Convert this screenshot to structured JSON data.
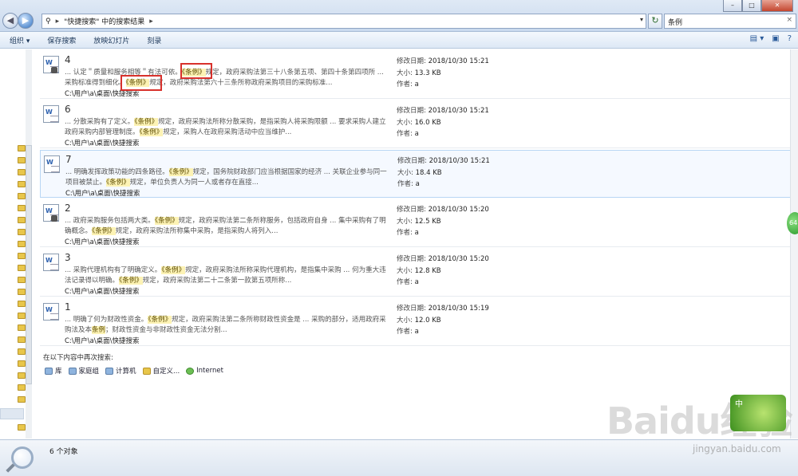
{
  "window": {
    "min": "–",
    "max": "□",
    "close": "✕"
  },
  "address": {
    "sep": "▸",
    "location": "\"快捷搜索\" 中的搜索结果",
    "sep2": "▸",
    "dropdown": "▾"
  },
  "search": {
    "value": "条例",
    "clear": "×"
  },
  "toolbar": {
    "organize": "组织 ▾",
    "save_search": "保存搜索",
    "slideshow": "放映幻灯片",
    "burn": "刻录"
  },
  "results": [
    {
      "title": "4",
      "snippet_pre1": "... 认定＂质量和服务相等＂有法可依。",
      "hl1": "《条例》",
      "snippet_mid1": "规定，政府采购法第三十八条第五项、第四十条第四项所 ... 采购标准得到细化。",
      "hl2": "《条例》",
      "snippet_post": "规定，政府采购法第六十三条所称政府采购项目的采购标准...",
      "path": "C:\\用户\\a\\桌面\\快捷搜索",
      "date_label": "修改日期:",
      "date": "2018/10/30 15:21",
      "size_label": "大小:",
      "size": "13.3 KB",
      "author_label": "作者:",
      "author": "a"
    },
    {
      "title": "6",
      "snippet_pre1": "... 分散采购有了定义。",
      "hl1": "《条例》",
      "snippet_mid1": "规定，政府采购法所称分散采购，是指采购人将采购限额 ... 要求采购人建立政府采购内部管理制度。",
      "hl2": "《条例》",
      "snippet_post": "规定，采购人在政府采购活动中应当维护...",
      "path": "C:\\用户\\a\\桌面\\快捷搜索",
      "date_label": "修改日期:",
      "date": "2018/10/30 15:21",
      "size_label": "大小:",
      "size": "16.0 KB",
      "author_label": "作者:",
      "author": "a"
    },
    {
      "title": "7",
      "snippet_pre1": "... 明确发挥政策功能的四条路径。",
      "hl1": "《条例》",
      "snippet_mid1": "规定，国务院财政部门应当根据国家的经济 ... 关联企业参与同一项目被禁止。",
      "hl2": "《条例》",
      "snippet_post": "规定，单位负责人为同一人或者存在直接...",
      "path": "C:\\用户\\a\\桌面\\快捷搜索",
      "date_label": "修改日期:",
      "date": "2018/10/30 15:21",
      "size_label": "大小:",
      "size": "18.4 KB",
      "author_label": "作者:",
      "author": "a"
    },
    {
      "title": "2",
      "snippet_pre1": "... 政府采购服务包括两大类。",
      "hl1": "《条例》",
      "snippet_mid1": "规定，政府采购法第二条所称服务，包括政府自身 ... 集中采购有了明确概念。",
      "hl2": "《条例》",
      "snippet_post": "规定，政府采购法所称集中采购，是指采购人将列入...",
      "path": "C:\\用户\\a\\桌面\\快捷搜索",
      "date_label": "修改日期:",
      "date": "2018/10/30 15:20",
      "size_label": "大小:",
      "size": "12.5 KB",
      "author_label": "作者:",
      "author": "a"
    },
    {
      "title": "3",
      "snippet_pre1": "... 采购代理机构有了明确定义。",
      "hl1": "《条例》",
      "snippet_mid1": "规定，政府采购法所称采购代理机构，是指集中采购 ... 何为重大违法记录得以明确。",
      "hl2": "《条例》",
      "snippet_post": "规定，政府采购法第二十二条第一款第五项所称...",
      "path": "C:\\用户\\a\\桌面\\快捷搜索",
      "date_label": "修改日期:",
      "date": "2018/10/30 15:20",
      "size_label": "大小:",
      "size": "12.8 KB",
      "author_label": "作者:",
      "author": "a"
    },
    {
      "title": "1",
      "snippet_pre1": "... 明确了何为财政性资金。",
      "hl1": "《条例》",
      "snippet_mid1": "规定，政府采购法第二条所称财政性资金是 ... 采购的部分，适用政府采购法及本",
      "hl2": "条例",
      "snippet_post": "；财政性资金与非财政性资金无法分割...",
      "path": "C:\\用户\\a\\桌面\\快捷搜索",
      "date_label": "修改日期:",
      "date": "2018/10/30 15:19",
      "size_label": "大小:",
      "size": "12.0 KB",
      "author_label": "作者:",
      "author": "a"
    }
  ],
  "research": {
    "label": "在以下内容中再次搜索:",
    "links": [
      "库",
      "家庭组",
      "计算机",
      "自定义...",
      "Internet"
    ]
  },
  "status": {
    "count": "6 个对象"
  },
  "watermark": {
    "brand": "Baidu经验",
    "url": "jingyan.baidu.com",
    "badge": "中"
  },
  "green_badge": "64"
}
